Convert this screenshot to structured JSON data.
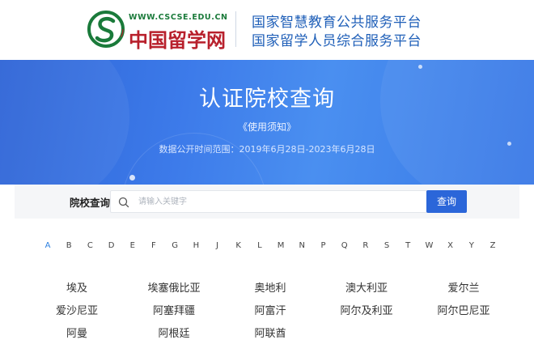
{
  "header": {
    "site_url": "WWW.CSCSE.EDU.CN",
    "site_name": "中国留学网",
    "platform_line1": "国家智慧教育公共服务平台",
    "platform_line2": "国家留学人员综合服务平台"
  },
  "banner": {
    "title": "认证院校查询",
    "notice": "《使用须知》",
    "date_range": "数据公开时间范围：2019年6月28日-2023年6月28日"
  },
  "search": {
    "label": "院校查询",
    "placeholder": "请输入关键字",
    "button": "查询"
  },
  "alphabet": {
    "letters": [
      "A",
      "B",
      "C",
      "D",
      "E",
      "F",
      "G",
      "H",
      "J",
      "K",
      "L",
      "M",
      "N",
      "P",
      "Q",
      "R",
      "S",
      "T",
      "W",
      "X",
      "Y",
      "Z"
    ],
    "active": "A"
  },
  "countries": [
    [
      "埃及",
      "埃塞俄比亚",
      "奥地利",
      "澳大利亚",
      "爱尔兰"
    ],
    [
      "爱沙尼亚",
      "阿塞拜疆",
      "阿富汗",
      "阿尔及利亚",
      "阿尔巴尼亚"
    ],
    [
      "阿曼",
      "阿根廷",
      "阿联酋"
    ]
  ],
  "colors": {
    "brand_blue": "#2b66d9",
    "banner_blue": "#3d7bea",
    "logo_red": "#b8202c",
    "logo_green": "#1a7a3a"
  }
}
